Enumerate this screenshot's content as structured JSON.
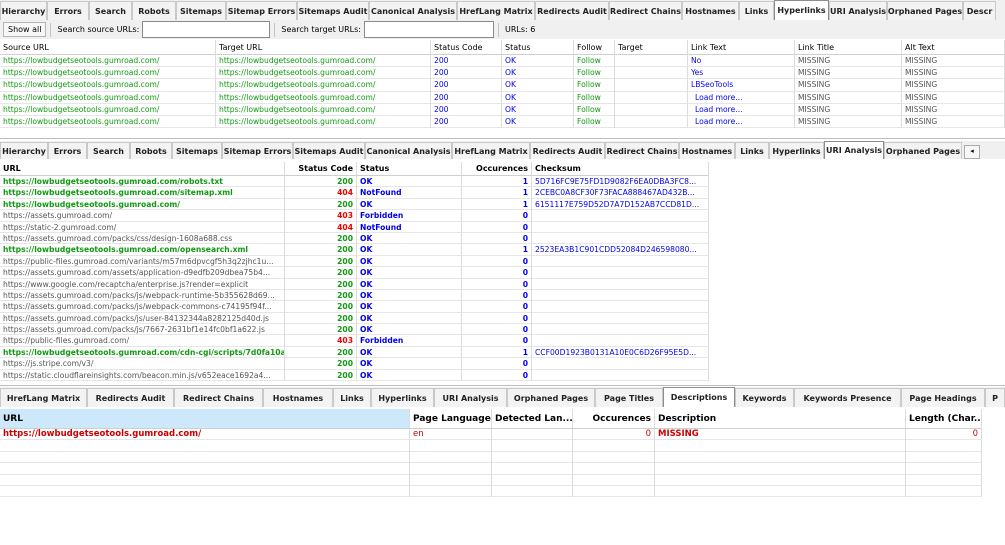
{
  "tabs_top": [
    {
      "label": "Hierarchy",
      "w": 47
    },
    {
      "label": "Errors",
      "w": 42
    },
    {
      "label": "Search",
      "w": 43
    },
    {
      "label": "Robots",
      "w": 44
    },
    {
      "label": "Sitemaps",
      "w": 50
    },
    {
      "label": "Sitemap Errors",
      "w": 71
    },
    {
      "label": "Sitemaps Audit",
      "w": 72
    },
    {
      "label": "Canonical Analysis",
      "w": 88
    },
    {
      "label": "HrefLang Matrix",
      "w": 78
    },
    {
      "label": "Redirects Audit",
      "w": 74
    },
    {
      "label": "Redirect Chains",
      "w": 73
    },
    {
      "label": "Hostnames",
      "w": 57
    },
    {
      "label": "Links",
      "w": 35
    },
    {
      "label": "Hyperlinks",
      "w": 55,
      "active": true
    },
    {
      "label": "URI Analysis",
      "w": 58
    },
    {
      "label": "Orphaned Pages",
      "w": 76
    },
    {
      "label": "Descr",
      "w": 33
    }
  ],
  "toolbar": {
    "show_all_label": "Show all",
    "search_source_label": "Search source URLs:",
    "search_target_label": "Search target URLs:",
    "urls_count_label": "URLs: 6"
  },
  "hyperlinks": {
    "columns": [
      {
        "label": "Source URL",
        "w": 216
      },
      {
        "label": "Target URL",
        "w": 215
      },
      {
        "label": "Status Code",
        "w": 71
      },
      {
        "label": "Status",
        "w": 72
      },
      {
        "label": "Follow",
        "w": 41
      },
      {
        "label": "Target",
        "w": 73
      },
      {
        "label": "Link Text",
        "w": 107
      },
      {
        "label": "Link Title",
        "w": 107
      },
      {
        "label": "Alt Text",
        "w": 103
      }
    ],
    "rows": [
      [
        "https://lowbudgetseotools.gumroad.com/",
        "https://lowbudgetseotools.gumroad.com/",
        "200",
        "OK",
        "Follow",
        "",
        "No",
        "MISSING",
        "MISSING"
      ],
      [
        "https://lowbudgetseotools.gumroad.com/",
        "https://lowbudgetseotools.gumroad.com/",
        "200",
        "OK",
        "Follow",
        "",
        "Yes",
        "MISSING",
        "MISSING"
      ],
      [
        "https://lowbudgetseotools.gumroad.com/",
        "https://lowbudgetseotools.gumroad.com/",
        "200",
        "OK",
        "Follow",
        "",
        "LBSeoTools",
        "MISSING",
        "MISSING"
      ],
      [
        "https://lowbudgetseotools.gumroad.com/",
        "https://lowbudgetseotools.gumroad.com/",
        "200",
        "OK",
        "Follow",
        "",
        "Load more...",
        "MISSING",
        "MISSING"
      ],
      [
        "https://lowbudgetseotools.gumroad.com/",
        "https://lowbudgetseotools.gumroad.com/",
        "200",
        "OK",
        "Follow",
        "",
        "Load more...",
        "MISSING",
        "MISSING"
      ],
      [
        "https://lowbudgetseotools.gumroad.com/",
        "https://lowbudgetseotools.gumroad.com/",
        "200",
        "OK",
        "Follow",
        "",
        "Load more...",
        "MISSING",
        "MISSING"
      ]
    ]
  },
  "tabs_mid": [
    {
      "label": "Hierarchy",
      "w": 48
    },
    {
      "label": "Errors",
      "w": 39
    },
    {
      "label": "Search",
      "w": 43
    },
    {
      "label": "Robots",
      "w": 42
    },
    {
      "label": "Sitemaps",
      "w": 50
    },
    {
      "label": "Sitemap Errors",
      "w": 71
    },
    {
      "label": "Sitemaps Audit",
      "w": 72
    },
    {
      "label": "Canonical Analysis",
      "w": 87
    },
    {
      "label": "HrefLang Matrix",
      "w": 78
    },
    {
      "label": "Redirects Audit",
      "w": 75
    },
    {
      "label": "Redirect Chains",
      "w": 74
    },
    {
      "label": "Hostnames",
      "w": 56
    },
    {
      "label": "Links",
      "w": 34
    },
    {
      "label": "Hyperlinks",
      "w": 55
    },
    {
      "label": "URI Analysis",
      "w": 60,
      "active": true
    },
    {
      "label": "Orphaned Pages",
      "w": 78
    }
  ],
  "uri_analysis": {
    "columns": [
      {
        "label": "URL",
        "w": 285,
        "align": "left"
      },
      {
        "label": "Status Code",
        "w": 72,
        "align": "right"
      },
      {
        "label": "Status",
        "w": 105,
        "align": "left"
      },
      {
        "label": "Occurences",
        "w": 70,
        "align": "right"
      },
      {
        "label": "Checksum",
        "w": 177,
        "align": "left"
      }
    ],
    "rows": [
      {
        "url": "https://lowbudgetseotools.gumroad.com/robots.txt",
        "code": "200",
        "status": "OK",
        "occ": "1",
        "sum": "5D716FC9E75FD1D9082F6EA0DBA3FC8...",
        "bold": true
      },
      {
        "url": "https://lowbudgetseotools.gumroad.com/sitemap.xml",
        "code": "404",
        "status": "NotFound",
        "occ": "1",
        "sum": "2CEBC0A8CF30F73FACA888467AD432B...",
        "bold": true
      },
      {
        "url": "https://lowbudgetseotools.gumroad.com/",
        "code": "200",
        "status": "OK",
        "occ": "1",
        "sum": "6151117E759D52D7A7D152AB7CCD81D...",
        "bold": true
      },
      {
        "url": "https://assets.gumroad.com/",
        "code": "403",
        "status": "Forbidden",
        "occ": "0",
        "sum": "",
        "bold": false
      },
      {
        "url": "https://static-2.gumroad.com/",
        "code": "404",
        "status": "NotFound",
        "occ": "0",
        "sum": "",
        "bold": false
      },
      {
        "url": "https://assets.gumroad.com/packs/css/design-1608a688.css",
        "code": "200",
        "status": "OK",
        "occ": "0",
        "sum": "",
        "bold": false
      },
      {
        "url": "https://lowbudgetseotools.gumroad.com/opensearch.xml",
        "code": "200",
        "status": "OK",
        "occ": "1",
        "sum": "2523EA3B1C901CDD52084D246598080...",
        "bold": true
      },
      {
        "url": "https://public-files.gumroad.com/variants/m57m6dpvcgf5h3q2zjhc1u...",
        "code": "200",
        "status": "OK",
        "occ": "0",
        "sum": "",
        "bold": false
      },
      {
        "url": "https://assets.gumroad.com/assets/application-d9edfb209dbea75b4...",
        "code": "200",
        "status": "OK",
        "occ": "0",
        "sum": "",
        "bold": false
      },
      {
        "url": "https://www.google.com/recaptcha/enterprise.js?render=explicit",
        "code": "200",
        "status": "OK",
        "occ": "0",
        "sum": "",
        "bold": false
      },
      {
        "url": "https://assets.gumroad.com/packs/js/webpack-runtime-5b355628d69...",
        "code": "200",
        "status": "OK",
        "occ": "0",
        "sum": "",
        "bold": false
      },
      {
        "url": "https://assets.gumroad.com/packs/js/webpack-commons-c74195f94f...",
        "code": "200",
        "status": "OK",
        "occ": "0",
        "sum": "",
        "bold": false
      },
      {
        "url": "https://assets.gumroad.com/packs/js/user-84132344a8282125d40d.js",
        "code": "200",
        "status": "OK",
        "occ": "0",
        "sum": "",
        "bold": false
      },
      {
        "url": "https://assets.gumroad.com/packs/js/7667-2631bf1e14fc0bf1a622.js",
        "code": "200",
        "status": "OK",
        "occ": "0",
        "sum": "",
        "bold": false
      },
      {
        "url": "https://public-files.gumroad.com/",
        "code": "403",
        "status": "Forbidden",
        "occ": "0",
        "sum": "",
        "bold": false
      },
      {
        "url": "https://lowbudgetseotools.gumroad.com/cdn-cgi/scripts/7d0fa10a/cl...",
        "code": "200",
        "status": "OK",
        "occ": "1",
        "sum": "CCF00D1923B0131A10E0C6D26F95E5D...",
        "bold": true
      },
      {
        "url": "https://js.stripe.com/v3/",
        "code": "200",
        "status": "OK",
        "occ": "0",
        "sum": "",
        "bold": false
      },
      {
        "url": "https://static.cloudflareinsights.com/beacon.min.js/v652eace1692a4...",
        "code": "200",
        "status": "OK",
        "occ": "0",
        "sum": "",
        "bold": false
      }
    ]
  },
  "tabs_bottom": [
    {
      "label": "HrefLang Matrix",
      "w": 87
    },
    {
      "label": "Redirects Audit",
      "w": 87
    },
    {
      "label": "Redirect Chains",
      "w": 89
    },
    {
      "label": "Hostnames",
      "w": 70
    },
    {
      "label": "Links",
      "w": 38
    },
    {
      "label": "Hyperlinks",
      "w": 63
    },
    {
      "label": "URI Analysis",
      "w": 73
    },
    {
      "label": "Orphaned Pages",
      "w": 88
    },
    {
      "label": "Page Titles",
      "w": 68
    },
    {
      "label": "Descriptions",
      "w": 72,
      "active": true
    },
    {
      "label": "Keywords",
      "w": 59
    },
    {
      "label": "Keywords Presence",
      "w": 107
    },
    {
      "label": "Page Headings",
      "w": 84
    },
    {
      "label": "P",
      "w": 20
    }
  ],
  "descriptions": {
    "columns": [
      {
        "label": "URL",
        "w": 410,
        "align": "left"
      },
      {
        "label": "Page Language",
        "w": 82,
        "align": "left"
      },
      {
        "label": "Detected Lan...",
        "w": 81,
        "align": "left"
      },
      {
        "label": "Occurences",
        "w": 82,
        "align": "right"
      },
      {
        "label": "Description",
        "w": 251,
        "align": "left"
      },
      {
        "label": "Length (Char...",
        "w": 76,
        "align": "right"
      }
    ],
    "rows": [
      {
        "url": "https://lowbudgetseotools.gumroad.com/",
        "lang": "en",
        "detected": "",
        "occ": "0",
        "desc": "MISSING",
        "len": "0"
      }
    ],
    "empty_rows": 5
  },
  "colors": {
    "green": "#119911",
    "blue": "#0000ee",
    "red": "#ee0000",
    "selected_header": "#cde8fb"
  }
}
